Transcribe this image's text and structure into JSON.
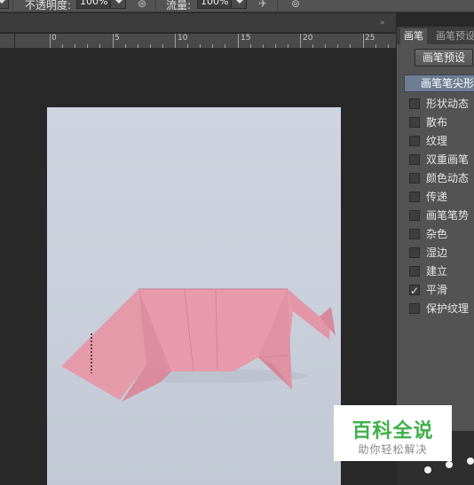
{
  "options_bar": {
    "opacity_label": "不透明度:",
    "opacity_value": "100%",
    "flow_label": "流量:",
    "flow_value": "100%",
    "icons": [
      "pressure-opacity-icon",
      "airbrush-icon",
      "pressure-size-icon"
    ]
  },
  "ruler": {
    "marks": [
      "0",
      "5",
      "10",
      "15",
      "20",
      "25"
    ]
  },
  "brush_panel": {
    "tabs": [
      {
        "label": "画笔",
        "active": true
      },
      {
        "label": "画笔预设",
        "active": false
      }
    ],
    "preset_button": "画笔预设",
    "tip_shape": "画笔笔尖形状",
    "options": [
      {
        "label": "形状动态",
        "checked": false
      },
      {
        "label": "散布",
        "checked": false
      },
      {
        "label": "纹理",
        "checked": false
      },
      {
        "label": "双重画笔",
        "checked": false
      },
      {
        "label": "颜色动态",
        "checked": false
      },
      {
        "label": "传递",
        "checked": false
      },
      {
        "label": "画笔笔势",
        "checked": false
      },
      {
        "label": "杂色",
        "checked": false
      },
      {
        "label": "湿边",
        "checked": false
      },
      {
        "label": "建立",
        "checked": false
      },
      {
        "label": "平滑",
        "checked": true
      },
      {
        "label": "保护纹理",
        "checked": false
      }
    ]
  },
  "watermark": {
    "title": "百科全说",
    "subtitle": "助你轻松解决"
  },
  "colors": {
    "pig_pink": "#e79aab",
    "paper": "#cbd2dd",
    "watermark_green": "#3fb04a"
  }
}
